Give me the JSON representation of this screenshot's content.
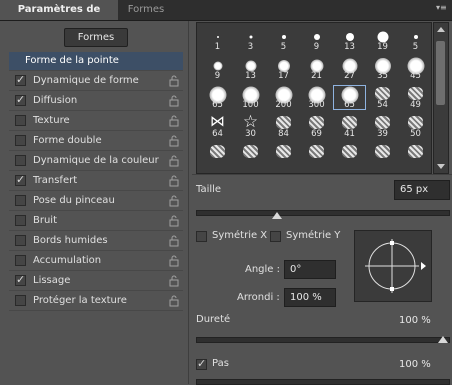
{
  "tabs": {
    "active": "Paramètres de forme",
    "inactive": "Formes"
  },
  "presets_button": "Formes",
  "options": [
    {
      "label": "Forme de la pointe",
      "checked": null,
      "selected": true,
      "lock": false
    },
    {
      "label": "Dynamique de forme",
      "checked": true,
      "lock": true
    },
    {
      "label": "Diffusion",
      "checked": true,
      "lock": true
    },
    {
      "label": "Texture",
      "checked": false,
      "lock": true
    },
    {
      "label": "Forme double",
      "checked": false,
      "lock": true
    },
    {
      "label": "Dynamique de la couleur",
      "checked": false,
      "lock": true
    },
    {
      "label": "Transfert",
      "checked": true,
      "lock": true
    },
    {
      "label": "Pose du pinceau",
      "checked": false,
      "lock": true
    },
    {
      "label": "Bruit",
      "checked": false,
      "lock": true
    },
    {
      "label": "Bords humides",
      "checked": false,
      "lock": true
    },
    {
      "label": "Accumulation",
      "checked": false,
      "lock": true
    },
    {
      "label": "Lissage",
      "checked": true,
      "lock": true
    },
    {
      "label": "Protéger la texture",
      "checked": false,
      "lock": true
    }
  ],
  "brushes": [
    [
      "1",
      "3",
      "5",
      "9",
      "13",
      "19",
      "5"
    ],
    [
      "9",
      "13",
      "17",
      "21",
      "27",
      "35",
      "45"
    ],
    [
      "65",
      "100",
      "200",
      "300",
      "65",
      "54",
      "49"
    ],
    [
      "64",
      "30",
      "84",
      "69",
      "41",
      "39",
      "50"
    ],
    [
      "",
      "",
      "",
      "",
      "",
      "",
      ""
    ]
  ],
  "selected_brush": "65",
  "size": {
    "label": "Taille",
    "value": "65 px"
  },
  "flip_x": {
    "label": "Symétrie X",
    "checked": false
  },
  "flip_y": {
    "label": "Symétrie Y",
    "checked": false
  },
  "angle": {
    "label": "Angle :",
    "value": "0°"
  },
  "roundness": {
    "label": "Arrondi :",
    "value": "100 %"
  },
  "hardness": {
    "label": "Dureté",
    "value": "100 %"
  },
  "spacing": {
    "label": "Pas",
    "value": "100 %",
    "checked": true
  }
}
